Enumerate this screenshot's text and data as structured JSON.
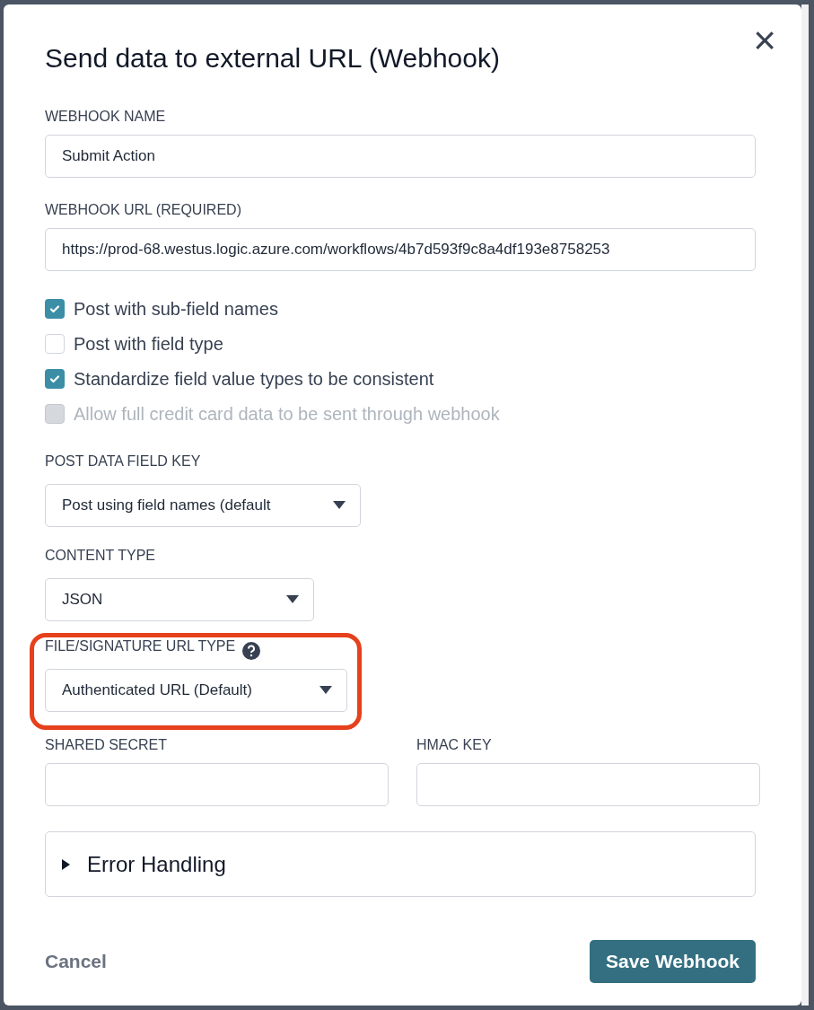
{
  "dialog": {
    "title": "Send data to external URL (Webhook)",
    "close_icon": "×"
  },
  "name_field": {
    "label": "WEBHOOK NAME",
    "value": "Submit Action"
  },
  "url_field": {
    "label": "WEBHOOK URL (REQUIRED)",
    "value": "https://prod-68.westus.logic.azure.com/workflows/4b7d593f9c8a4df193e8758253"
  },
  "options": [
    {
      "label": "Post with sub-field names",
      "checked": true,
      "disabled": false
    },
    {
      "label": "Post with field type",
      "checked": false,
      "disabled": false
    },
    {
      "label": "Standardize field value types to be consistent",
      "checked": true,
      "disabled": false
    },
    {
      "label": "Allow full credit card data to be sent through webhook",
      "checked": false,
      "disabled": true
    }
  ],
  "selects": [
    {
      "label": "POST DATA FIELD KEY",
      "value": "Post using field names (default",
      "help": false,
      "highlighted": false
    },
    {
      "label": "CONTENT TYPE",
      "value": "JSON",
      "help": false,
      "highlighted": false
    },
    {
      "label": "FILE/SIGNATURE URL TYPE",
      "value": "Authenticated URL (Default)",
      "help": true,
      "highlighted": true
    }
  ],
  "secrets": [
    {
      "label": "SHARED SECRET"
    },
    {
      "label": "HMAC KEY"
    }
  ],
  "error_handling": {
    "label": "Error Handling",
    "expanded": false
  },
  "buttons": {
    "cancel": "Cancel",
    "save": "Save Webhook"
  }
}
